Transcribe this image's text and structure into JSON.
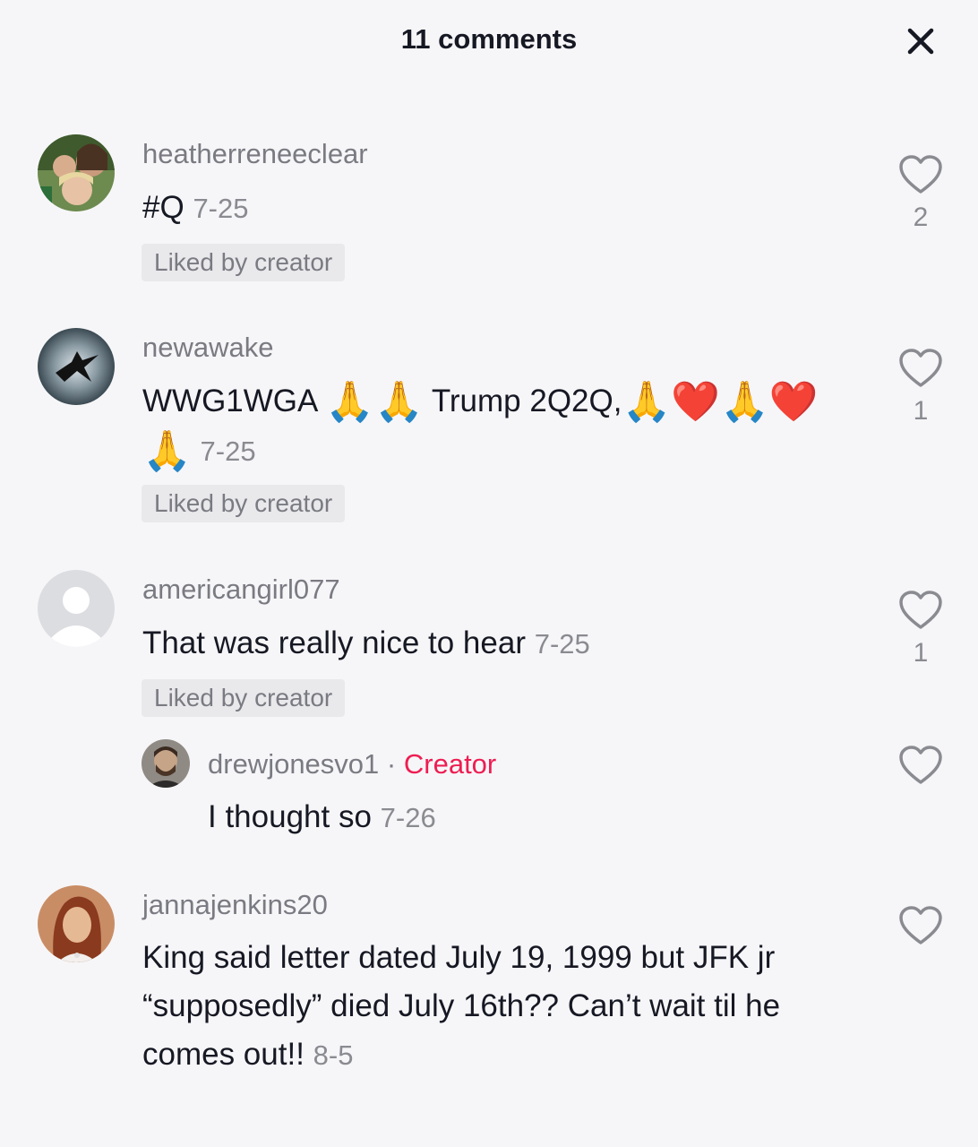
{
  "header": {
    "title": "11 comments",
    "close_icon": "close-icon"
  },
  "comments": [
    {
      "username": "heatherreneeclear",
      "text": "#Q",
      "date": "7-25",
      "badge": "Liked by creator",
      "likes": "2"
    },
    {
      "username": "newawake",
      "text_parts": [
        "WWG1WGA ",
        "🙏🙏",
        " Trump 2Q2Q,",
        "🙏❤️🙏❤️",
        "🙏"
      ],
      "date": "7-25",
      "badge": "Liked by creator",
      "likes": "1"
    },
    {
      "username": "americangirl077",
      "text": "That was really nice to hear",
      "date": "7-25",
      "badge": "Liked by creator",
      "likes": "1"
    },
    {
      "username": "drewjonesvo1",
      "separator": "·",
      "creator_label": "Creator",
      "text": "I thought so",
      "date": "7-26"
    },
    {
      "username": "jannajenkins20",
      "text": "King said letter dated July 19, 1999 but JFK jr “supposedly” died July 16th?? Can’t wait til he comes out!!",
      "date": "8-5"
    }
  ],
  "colors": {
    "background": "#f6f6f8",
    "creator_accent": "#ee1d52",
    "badge_bg": "#e9e9ec"
  }
}
